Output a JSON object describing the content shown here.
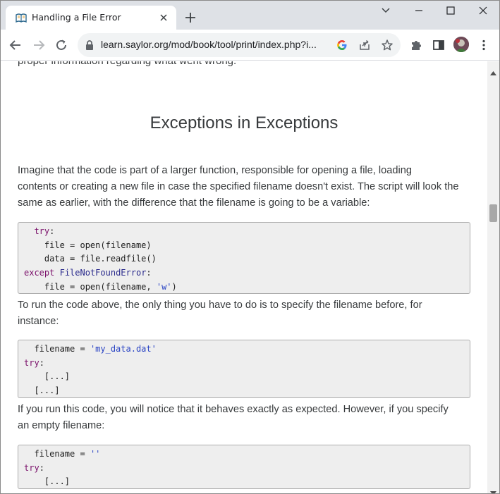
{
  "browser": {
    "tab_title": "Handling a File Error",
    "url": "learn.saylor.org/mod/book/tool/print/index.php?i..."
  },
  "colors": {
    "tabstrip": "#dee1e6",
    "code_background": "#eeeeee",
    "keyword": "#7a0f6a",
    "string": "#2a44c4"
  },
  "icons": {
    "favicon": "book-favicon",
    "tab_close": "close-icon",
    "new_tab": "plus-icon",
    "tab_search": "chevron-down-icon",
    "back": "arrow-left-icon",
    "forward": "arrow-right-icon",
    "reload": "reload-icon",
    "lock": "lock-icon",
    "google": "google-icon",
    "share": "share-icon",
    "bookmark": "star-icon",
    "extensions": "puzzle-icon",
    "side_panel": "side-panel-icon",
    "menu": "kebab-menu-icon"
  },
  "page": {
    "cut_line": "proper information regarding what went wrong.",
    "heading": "Exceptions in Exceptions",
    "para1": {
      "line1": "Imagine that the code is part of a larger function, responsible for opening a file, loading",
      "line2": "contents or creating a new file in case the specified filename doesn't exist. The script will look the",
      "line3": "same as earlier, with the difference that the filename is going to be a variable:"
    },
    "code1": {
      "l1_kw": "try",
      "l1_rest": ":",
      "l2": "file = open(filename)",
      "l3": "data = file.readfile()",
      "l4_kw": "except",
      "l4_cls": "FileNotFoundError",
      "l4_rest": ":",
      "l5_pre": "file = open(filename, ",
      "l5_str": "'w'",
      "l5_post": ")"
    },
    "para2": {
      "line1": "To run the code above, the only thing you have to do is to specify the filename before, for",
      "line2": "instance:"
    },
    "code2": {
      "l1_pre": "filename = ",
      "l1_str": "'my_data.dat'",
      "l2_kw": "try",
      "l2_rest": ":",
      "l3": "[...]",
      "l4": "[...]"
    },
    "para3": {
      "line1": "If you run this code, you will notice that it behaves exactly as expected. However, if you specify",
      "line2": "an empty filename:"
    },
    "code3": {
      "l1_pre": "filename = ",
      "l1_str": "''",
      "l2_kw": "try",
      "l2_rest": ":",
      "l3": "[...]"
    }
  }
}
